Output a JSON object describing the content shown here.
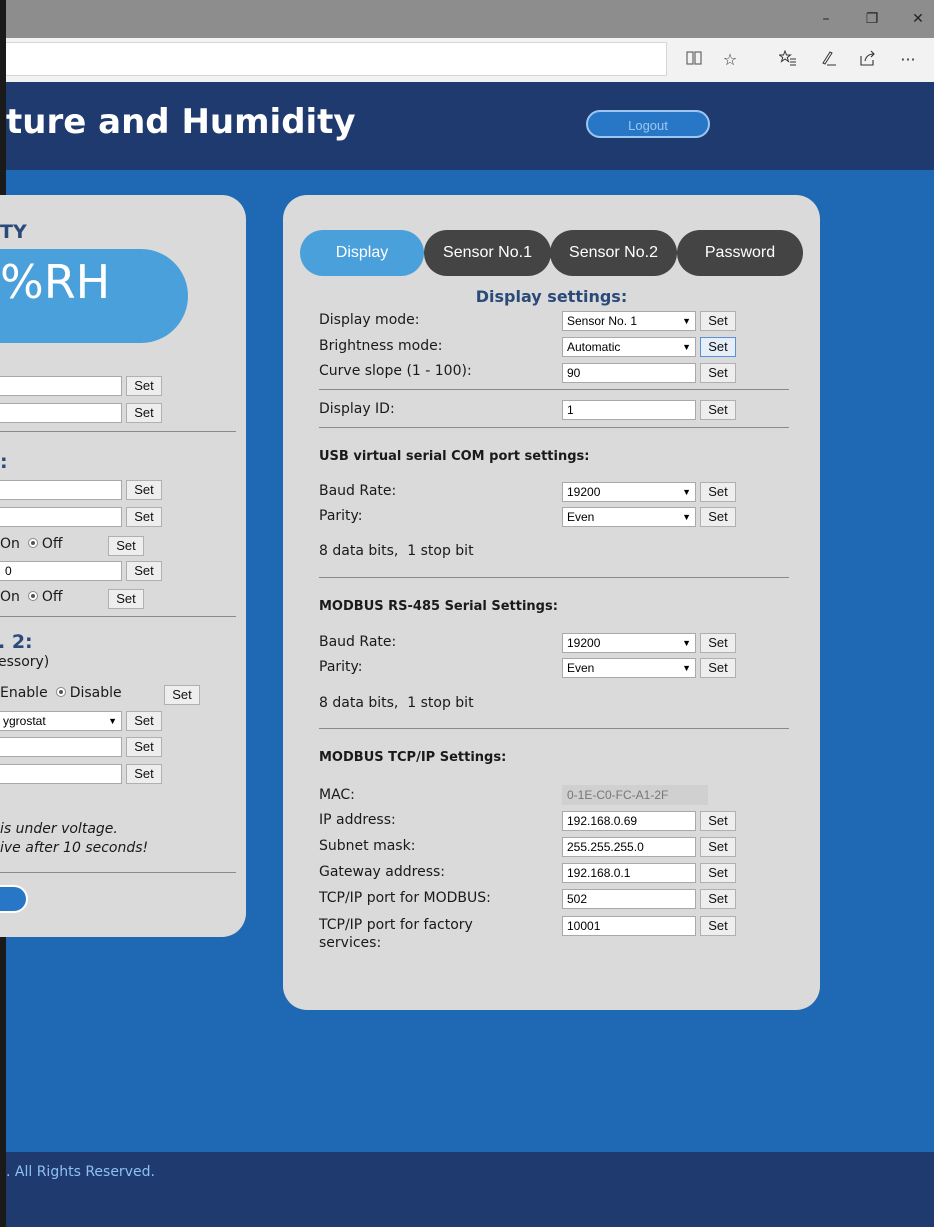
{
  "browser": {
    "minimize": "–",
    "restore": "❐",
    "close": "✕",
    "toolbar_icons": [
      "reading-view-icon",
      "favorite-star-icon",
      "favorites-hub-icon",
      "pen-icon",
      "share-icon",
      "more-icon"
    ]
  },
  "header": {
    "title": "ture and Humidity",
    "logout_label": "Logout"
  },
  "left_panel": {
    "title_fragment": "TY",
    "humidity_reading": "%RH",
    "set_label": "Set",
    "section2_title": ":",
    "field_value_0": "0",
    "on_label": "On",
    "off_label": "Off",
    "section3_title": ". 2:",
    "section3_subtitle": "essory)",
    "enable_label": "Enable",
    "disable_label": "Disable",
    "select_value": "ygrostat",
    "warning_line1": " is under voltage.",
    "warning_line2": "ive after 10 seconds!"
  },
  "tabs": [
    {
      "label": "Display"
    },
    {
      "label": "Sensor No.1"
    },
    {
      "label": "Sensor No.2"
    },
    {
      "label": "Password"
    }
  ],
  "display_settings": {
    "heading": "Display settings:",
    "set_label": "Set",
    "display_mode_label": "Display mode:",
    "display_mode_value": "Sensor No. 1",
    "brightness_mode_label": "Brightness mode:",
    "brightness_mode_value": "Automatic",
    "curve_slope_label": "Curve slope (1 - 100):",
    "curve_slope_value": "90",
    "display_id_label": "Display ID:",
    "display_id_value": "1"
  },
  "usb_settings": {
    "heading": "USB virtual serial COM port settings:",
    "baud_label": "Baud Rate:",
    "baud_value": "19200",
    "parity_label": "Parity:",
    "parity_value": "Even",
    "note": "8 data bits,  1 stop bit"
  },
  "modbus_serial": {
    "heading": "MODBUS RS-485 Serial Settings:",
    "baud_label": "Baud Rate:",
    "baud_value": "19200",
    "parity_label": "Parity:",
    "parity_value": "Even",
    "note": "8 data bits,  1 stop bit"
  },
  "modbus_tcp": {
    "heading": "MODBUS TCP/IP Settings:",
    "mac_label": "MAC:",
    "mac_value": "0-1E-C0-FC-A1-2F",
    "ip_label": "IP address:",
    "ip_value": "192.168.0.69",
    "subnet_label": "Subnet mask:",
    "subnet_value": "255.255.255.0",
    "gateway_label": "Gateway address:",
    "gateway_value": "192.168.0.1",
    "modbus_port_label": "TCP/IP port for MODBUS:",
    "modbus_port_value": "502",
    "factory_port_label_1": "TCP/IP port for factory",
    "factory_port_label_2": "services:",
    "factory_port_value": "10001"
  },
  "footer": {
    "text": ". All Rights Reserved."
  }
}
